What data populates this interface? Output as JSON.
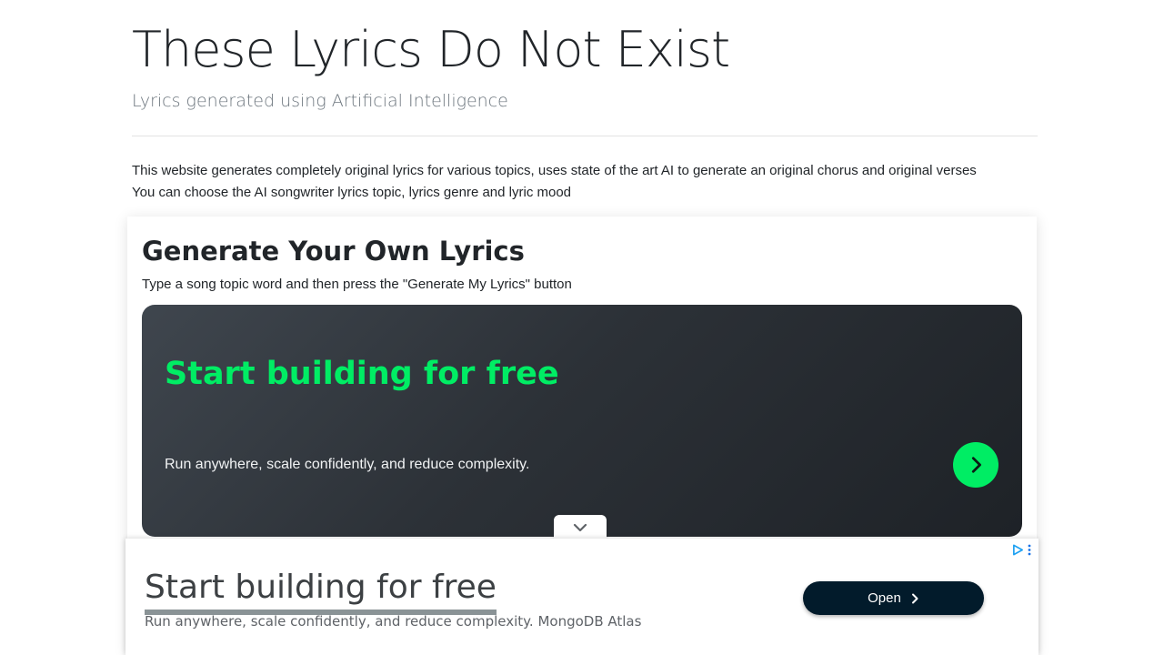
{
  "header": {
    "title": "These Lyrics Do Not Exist",
    "subtitle": "Lyrics generated using Artificial Intelligence"
  },
  "intro": {
    "line1": "This website generates completely original lyrics for various topics, uses state of the art AI to generate an original chorus and original verses",
    "line2": "You can choose the AI songwriter lyrics topic, lyrics genre and lyric mood"
  },
  "generator": {
    "title": "Generate Your Own Lyrics",
    "instructions": "Type a song topic word and then press the \"Generate My Lyrics\" button"
  },
  "banner_ad": {
    "headline": "Start building for free",
    "body": "Run anywhere, scale confidently, and reduce complexity.",
    "cta_icon": "chevron-right-icon",
    "accent_color": "#00ed64",
    "background_color": "#2c3137"
  },
  "collapse_tab": {
    "icon": "chevron-down-icon"
  },
  "anchor_ad": {
    "headline": "Start building for free",
    "body": "Run anywhere, scale confidently, and reduce complexity. MongoDB Atlas",
    "open_label": "Open",
    "open_icon": "chevron-right-icon",
    "adchoices_icon": "adchoices-icon",
    "button_color": "#021b2b"
  }
}
